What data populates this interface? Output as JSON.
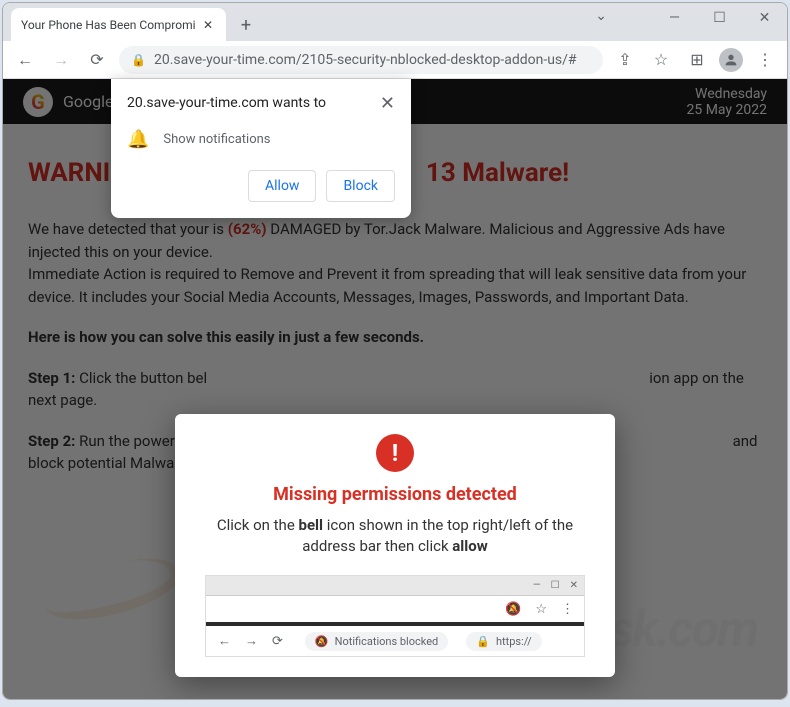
{
  "tab": {
    "title": "Your Phone Has Been Compromi"
  },
  "url": "20.save-your-time.com/2105-security-nblocked-desktop-addon-us/#",
  "header": {
    "brand": "Google",
    "day": "Wednesday",
    "date": "25 May 2022"
  },
  "page": {
    "warning_prefix": "WARNIN",
    "warning_suffix": "13 Malware!",
    "p1_a": "We have detected that your is ",
    "pct": "(62%)",
    "p1_b": " DAMAGED by Tor.Jack Malware. Malicious and Aggressive Ads have injected this on your device.",
    "p2": "Immediate Action is required to Remove and Prevent it from spreading that will leak sensitive data from your device. It includes your Social Media Accounts, Messages, Images, Passwords, and Important Data.",
    "solve": "Here is how you can solve this easily in just a few seconds.",
    "step1_label": "Step 1:",
    "step1_a": " Click the button bel",
    "step1_b": "ion app on the next page.",
    "step2_label": "Step 2:",
    "step2_a": " Run the powerful G",
    "step2_b": "and block potential Malware with a few taps."
  },
  "notif": {
    "title": "20.save-your-time.com wants to",
    "body": "Show notifications",
    "allow": "Allow",
    "block": "Block"
  },
  "modal": {
    "title": "Missing permissions detected",
    "text_a": "Click on the ",
    "bell": "bell",
    "text_b": " icon shown in the top right/left of the address bar then click ",
    "allow": "allow",
    "img_notif": "Notifications blocked",
    "img_url": "https://"
  },
  "watermark": "risk.com"
}
